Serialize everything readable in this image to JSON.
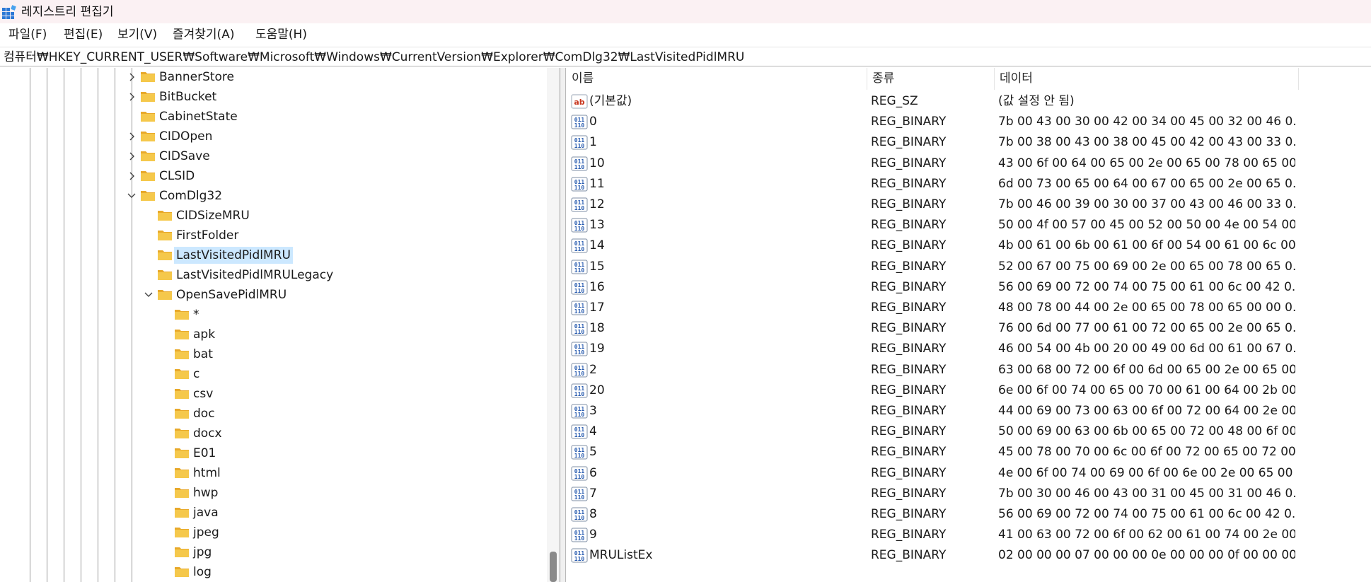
{
  "window": {
    "title": "레지스트리 편집기",
    "icon": "registry-editor-icon"
  },
  "menu": {
    "items": [
      "파일(F)",
      "편집(E)",
      "보기(V)",
      "즐겨찾기(A)",
      "도움말(H)"
    ]
  },
  "address": {
    "path": "컴퓨터₩HKEY_CURRENT_USER₩Software₩Microsoft₩Windows₩CurrentVersion₩Explorer₩ComDlg32₩LastVisitedPidlMRU"
  },
  "tree": {
    "items": [
      {
        "label": "BannerStore",
        "expander": "collapsed"
      },
      {
        "label": "BitBucket",
        "expander": "collapsed"
      },
      {
        "label": "CabinetState",
        "expander": "none"
      },
      {
        "label": "CIDOpen",
        "expander": "collapsed"
      },
      {
        "label": "CIDSave",
        "expander": "collapsed"
      },
      {
        "label": "CLSID",
        "expander": "collapsed"
      },
      {
        "label": "ComDlg32",
        "expander": "expanded"
      },
      {
        "label": "CIDSizeMRU",
        "expander": "none"
      },
      {
        "label": "FirstFolder",
        "expander": "none"
      },
      {
        "label": "LastVisitedPidlMRU",
        "expander": "none",
        "selected": true
      },
      {
        "label": "LastVisitedPidlMRULegacy",
        "expander": "none"
      },
      {
        "label": "OpenSavePidlMRU",
        "expander": "expanded"
      },
      {
        "label": "*",
        "expander": "none"
      },
      {
        "label": "apk",
        "expander": "none"
      },
      {
        "label": "bat",
        "expander": "none"
      },
      {
        "label": "c",
        "expander": "none"
      },
      {
        "label": "csv",
        "expander": "none"
      },
      {
        "label": "doc",
        "expander": "none"
      },
      {
        "label": "docx",
        "expander": "none"
      },
      {
        "label": "E01",
        "expander": "none"
      },
      {
        "label": "html",
        "expander": "none"
      },
      {
        "label": "hwp",
        "expander": "none"
      },
      {
        "label": "java",
        "expander": "none"
      },
      {
        "label": "jpeg",
        "expander": "none"
      },
      {
        "label": "jpg",
        "expander": "none"
      },
      {
        "label": "log",
        "expander": "none"
      }
    ]
  },
  "values": {
    "headers": {
      "name": "이름",
      "type": "종류",
      "data": "데이터"
    },
    "rows": [
      {
        "name": "(기본값)",
        "type": "REG_SZ",
        "data": "(값 설정 안 됨)",
        "icon": "string-value-icon"
      },
      {
        "name": "0",
        "type": "REG_BINARY",
        "data": "7b 00 43 00 30 00 42 00 34 00 45 00 32 00 46 0...",
        "icon": "binary-value-icon"
      },
      {
        "name": "1",
        "type": "REG_BINARY",
        "data": "7b 00 38 00 43 00 38 00 45 00 42 00 43 00 33 0...",
        "icon": "binary-value-icon"
      },
      {
        "name": "10",
        "type": "REG_BINARY",
        "data": "43 00 6f 00 64 00 65 00 2e 00 65 00 78 00 65 00...",
        "icon": "binary-value-icon"
      },
      {
        "name": "11",
        "type": "REG_BINARY",
        "data": "6d 00 73 00 65 00 64 00 67 00 65 00 2e 00 65 0...",
        "icon": "binary-value-icon"
      },
      {
        "name": "12",
        "type": "REG_BINARY",
        "data": "7b 00 46 00 39 00 30 00 37 00 43 00 46 00 33 0...",
        "icon": "binary-value-icon"
      },
      {
        "name": "13",
        "type": "REG_BINARY",
        "data": "50 00 4f 00 57 00 45 00 52 00 50 00 4e 00 54 00...",
        "icon": "binary-value-icon"
      },
      {
        "name": "14",
        "type": "REG_BINARY",
        "data": "4b 00 61 00 6b 00 61 00 6f 00 54 00 61 00 6c 00...",
        "icon": "binary-value-icon"
      },
      {
        "name": "15",
        "type": "REG_BINARY",
        "data": "52 00 67 00 75 00 69 00 2e 00 65 00 78 00 65 0...",
        "icon": "binary-value-icon"
      },
      {
        "name": "16",
        "type": "REG_BINARY",
        "data": "56 00 69 00 72 00 74 00 75 00 61 00 6c 00 42 0...",
        "icon": "binary-value-icon"
      },
      {
        "name": "17",
        "type": "REG_BINARY",
        "data": "48 00 78 00 44 00 2e 00 65 00 78 00 65 00 00 0...",
        "icon": "binary-value-icon"
      },
      {
        "name": "18",
        "type": "REG_BINARY",
        "data": "76 00 6d 00 77 00 61 00 72 00 65 00 2e 00 65 0...",
        "icon": "binary-value-icon"
      },
      {
        "name": "19",
        "type": "REG_BINARY",
        "data": "46 00 54 00 4b 00 20 00 49 00 6d 00 61 00 67 0...",
        "icon": "binary-value-icon"
      },
      {
        "name": "2",
        "type": "REG_BINARY",
        "data": "63 00 68 00 72 00 6f 00 6d 00 65 00 2e 00 65 00...",
        "icon": "binary-value-icon"
      },
      {
        "name": "20",
        "type": "REG_BINARY",
        "data": "6e 00 6f 00 74 00 65 00 70 00 61 00 64 00 2b 00...",
        "icon": "binary-value-icon"
      },
      {
        "name": "3",
        "type": "REG_BINARY",
        "data": "44 00 69 00 73 00 63 00 6f 00 72 00 64 00 2e 00...",
        "icon": "binary-value-icon"
      },
      {
        "name": "4",
        "type": "REG_BINARY",
        "data": "50 00 69 00 63 00 6b 00 65 00 72 00 48 00 6f 00...",
        "icon": "binary-value-icon"
      },
      {
        "name": "5",
        "type": "REG_BINARY",
        "data": "45 00 78 00 70 00 6c 00 6f 00 72 00 65 00 72 00...",
        "icon": "binary-value-icon"
      },
      {
        "name": "6",
        "type": "REG_BINARY",
        "data": "4e 00 6f 00 74 00 69 00 6f 00 6e 00 2e 00 65 00 ...",
        "icon": "binary-value-icon"
      },
      {
        "name": "7",
        "type": "REG_BINARY",
        "data": "7b 00 30 00 46 00 43 00 31 00 45 00 31 00 46 0...",
        "icon": "binary-value-icon"
      },
      {
        "name": "8",
        "type": "REG_BINARY",
        "data": "56 00 69 00 72 00 74 00 75 00 61 00 6c 00 42 0...",
        "icon": "binary-value-icon"
      },
      {
        "name": "9",
        "type": "REG_BINARY",
        "data": "41 00 63 00 72 00 6f 00 62 00 61 00 74 00 2e 00...",
        "icon": "binary-value-icon"
      },
      {
        "name": "MRUListEx",
        "type": "REG_BINARY",
        "data": "02 00 00 00 07 00 00 00 0e 00 00 00 0f 00 00 00...",
        "icon": "binary-value-icon"
      }
    ]
  },
  "colors": {
    "titlebar_bg": "#fbf1f3",
    "selection_bg": "#cce8ff",
    "folder_yellow": "#f5c84b"
  }
}
